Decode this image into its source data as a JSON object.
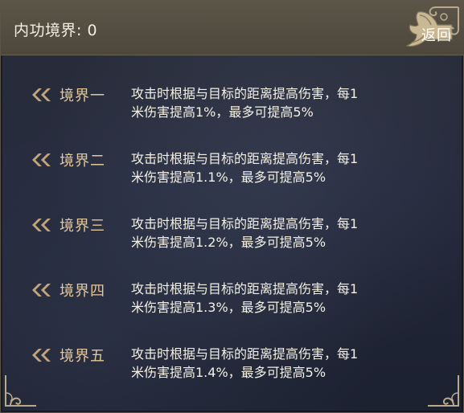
{
  "header": {
    "title": "内功境界: 0",
    "back_label": "返回"
  },
  "levels": [
    {
      "name": "境界一",
      "line1": "攻击时根据与目标的距离提高伤害，每1",
      "line2": "米伤害提高1%，最多可提高5%"
    },
    {
      "name": "境界二",
      "line1": "攻击时根据与目标的距离提高伤害，每1",
      "line2": "米伤害提高1.1%，最多可提高5%"
    },
    {
      "name": "境界三",
      "line1": "攻击时根据与目标的距离提高伤害，每1",
      "line2": "米伤害提高1.2%，最多可提高5%"
    },
    {
      "name": "境界四",
      "line1": "攻击时根据与目标的距离提高伤害，每1",
      "line2": "米伤害提高1.3%，最多可提高5%"
    },
    {
      "name": "境界五",
      "line1": "攻击时根据与目标的距离提高伤害，每1",
      "line2": "米伤害提高1.4%，最多可提高5%"
    }
  ],
  "colors": {
    "level_name": "#e4c89a",
    "description": "#f4f0e6",
    "header_bg": "#4d473c",
    "ornament": "#b9a98a"
  },
  "icons": {
    "bullet": "double-chevron-left-icon",
    "back": "scroll-arrow-icon",
    "corner": "cloud-swirl-ornament-icon"
  }
}
